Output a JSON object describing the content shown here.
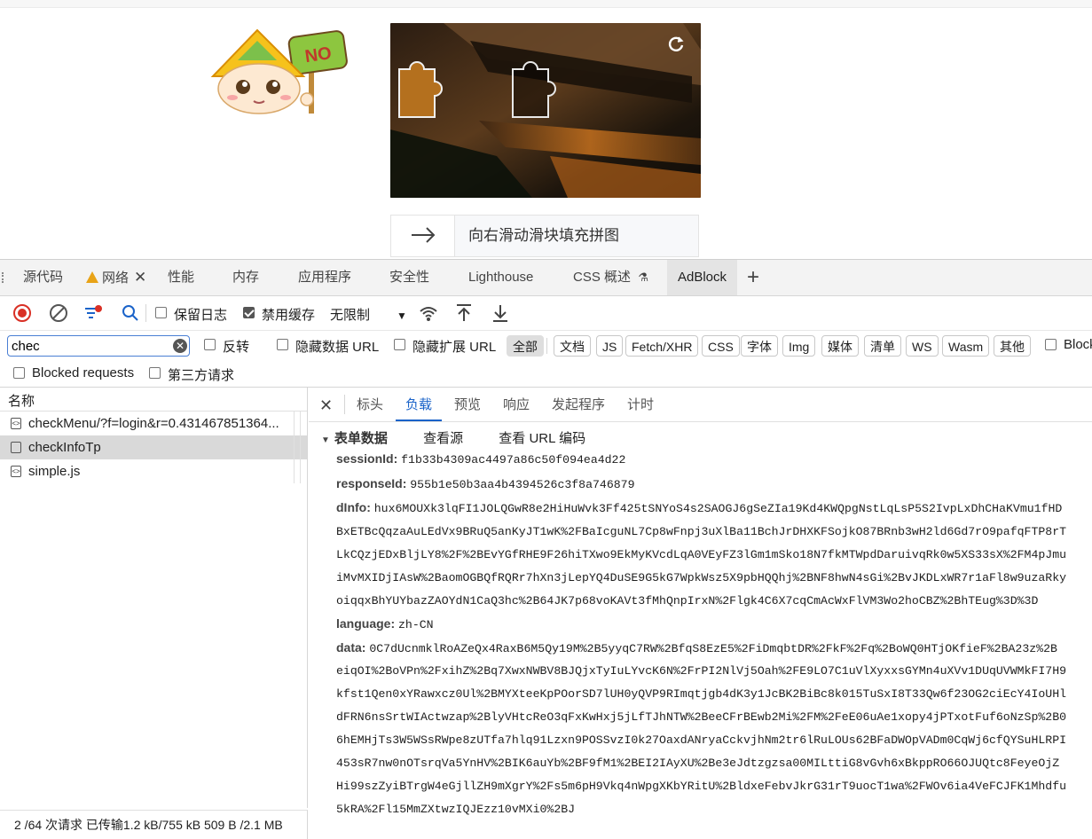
{
  "page": {
    "slider_hint": "向右滑动滑块填充拼图",
    "mascot_sign": "NO"
  },
  "devtools": {
    "tabs": [
      {
        "label": "源代码"
      },
      {
        "label": "网络"
      },
      {
        "label": "性能"
      },
      {
        "label": "内存"
      },
      {
        "label": "应用程序"
      },
      {
        "label": "安全性"
      },
      {
        "label": "Lighthouse"
      },
      {
        "label": "CSS 概述"
      },
      {
        "label": "AdBlock"
      }
    ],
    "toolbar": {
      "preserve_log": "保留日志",
      "disable_cache": "禁用缓存",
      "throttle": "无限制"
    },
    "filter": {
      "value": "chec",
      "invert": "反转",
      "hide_data_url": "隐藏数据 URL",
      "hide_ext_url": "隐藏扩展 URL",
      "types": [
        "全部",
        "文档",
        "JS",
        "Fetch/XHR",
        "CSS",
        "字体",
        "Img",
        "媒体",
        "清单",
        "WS",
        "Wasm",
        "其他"
      ],
      "blocked_cookies": "Block",
      "blocked_requests": "Blocked requests",
      "third_party": "第三方请求"
    },
    "requests": {
      "header": "名称",
      "rows": [
        {
          "name": "checkMenu/?f=login&r=0.431467851364..."
        },
        {
          "name": "checkInfoTp"
        },
        {
          "name": "simple.js"
        }
      ],
      "status": "2 /64 次请求  已传输1.2 kB/755 kB  509 B /2.1 MB"
    },
    "detail": {
      "tabs": [
        "标头",
        "负载",
        "预览",
        "响应",
        "发起程序",
        "计时"
      ],
      "active_tab": "负载",
      "section": "表单数据",
      "view_source": "查看源",
      "view_url_encoded": "查看 URL 编码",
      "fields": {
        "sessionId_key": "sessionId:",
        "sessionId": "f1b33b4309ac4497a86c50f094ea4d22",
        "responseId_key": "responseId:",
        "responseId": "955b1e50b3aa4b4394526c3f8a746879",
        "dInfo_key": "dInfo:",
        "dInfo_lines": [
          "hux6MOUXk3lqFI1JOLQGwR8e2HiHuWvk3Ff425tSNYoS4s2SAOGJ6gSeZIa19Kd4KWQpgNstLqLsP5S2IvpLxDhCHaKVmu1fHD",
          "BxETBcQqzaAuLEdVx9BRuQ5anKyJT1wK%2FBaIcguNL7Cp8wFnpj3uXlBa11BchJrDHXKFSojkO87BRnb3wH2ld6Gd7rO9pafqFTP8rT",
          "LkCQzjEDxBljLY8%2F%2BEvYGfRHE9F26hiTXwo9EkMyKVcdLqA0VEyFZ3lGm1mSko18N7fkMTWpdDaruivqRk0w5XS33sX%2FM4pJmu",
          "iMvMXIDjIAsW%2BaomOGBQfRQRr7hXn3jLepYQ4DuSE9G5kG7WpkWsz5X9pbHQQhj%2BNF8hwN4sGi%2BvJKDLxWR7r1aFl8w9uzaRky",
          "oiqqxBhYUYbazZAOYdN1CaQ3hc%2B64JK7p68voKAVt3fMhQnpIrxN%2Flgk4C6X7cqCmAcWxFlVM3Wo2hoCBZ%2BhTEug%3D%3D"
        ],
        "language_key": "language:",
        "language": "zh-CN",
        "data_key": "data:",
        "data_lines": [
          "0C7dUcnmklRoAZeQx4RaxB6M5Qy19M%2B5yyqC7RW%2BfqS8EzE5%2FiDmqbtDR%2FkF%2Fq%2BoWQ0HTjOKfieF%2BA23z%2B",
          "eiqOI%2BoVPn%2FxihZ%2Bq7XwxNWBV8BJQjxTyIuLYvcK6N%2FrPI2NlVj5Oah%2FE9LO7C1uVlXyxxsGYMn4uXVv1DUqUVWMkFI7H9",
          "kfst1Qen0xYRawxcz0Ul%2BMYXteeKpPOorSD7lUH0yQVP9RImqtjgb4dK3y1JcBK2BiBc8k015TuSxI8T33Qw6f23OG2ciEcY4IoUHl",
          "dFRN6nsSrtWIActwzap%2BlyVHtcReO3qFxKwHxj5jLfTJhNTW%2BeeCFrBEwb2Mi%2FM%2FeE06uAe1xopy4jPTxotFuf6oNzSp%2B0",
          "6hEMHjTs3W5WSsRWpe8zUTfa7hlq91Lzxn9POSSvzI0k27OaxdANryaCckvjhNm2tr6lRuLOUs62BFaDWOpVADm0CqWj6cfQYSuHLRPI",
          "453sR7nw0nOTsrqVa5YnHV%2BIK6auYb%2BF9fM1%2BEI2IAyXU%2Be3eJdtzgzsa00MILttiG8vGvh6xBkppRO66OJUQtc8FeyeOjZ",
          "Hi99szZyiBTrgW4eGjllZH9mXgrY%2Fs5m6pH9Vkq4nWpgXKbYRitU%2BldxeFebvJkrG31rT9uocT1wa%2FWOv6ia4VeFCJFK1Mhdfu",
          "5kRA%2Fl15MmZXtwzIQJEzz10vMXi0%2BJ"
        ]
      }
    }
  }
}
